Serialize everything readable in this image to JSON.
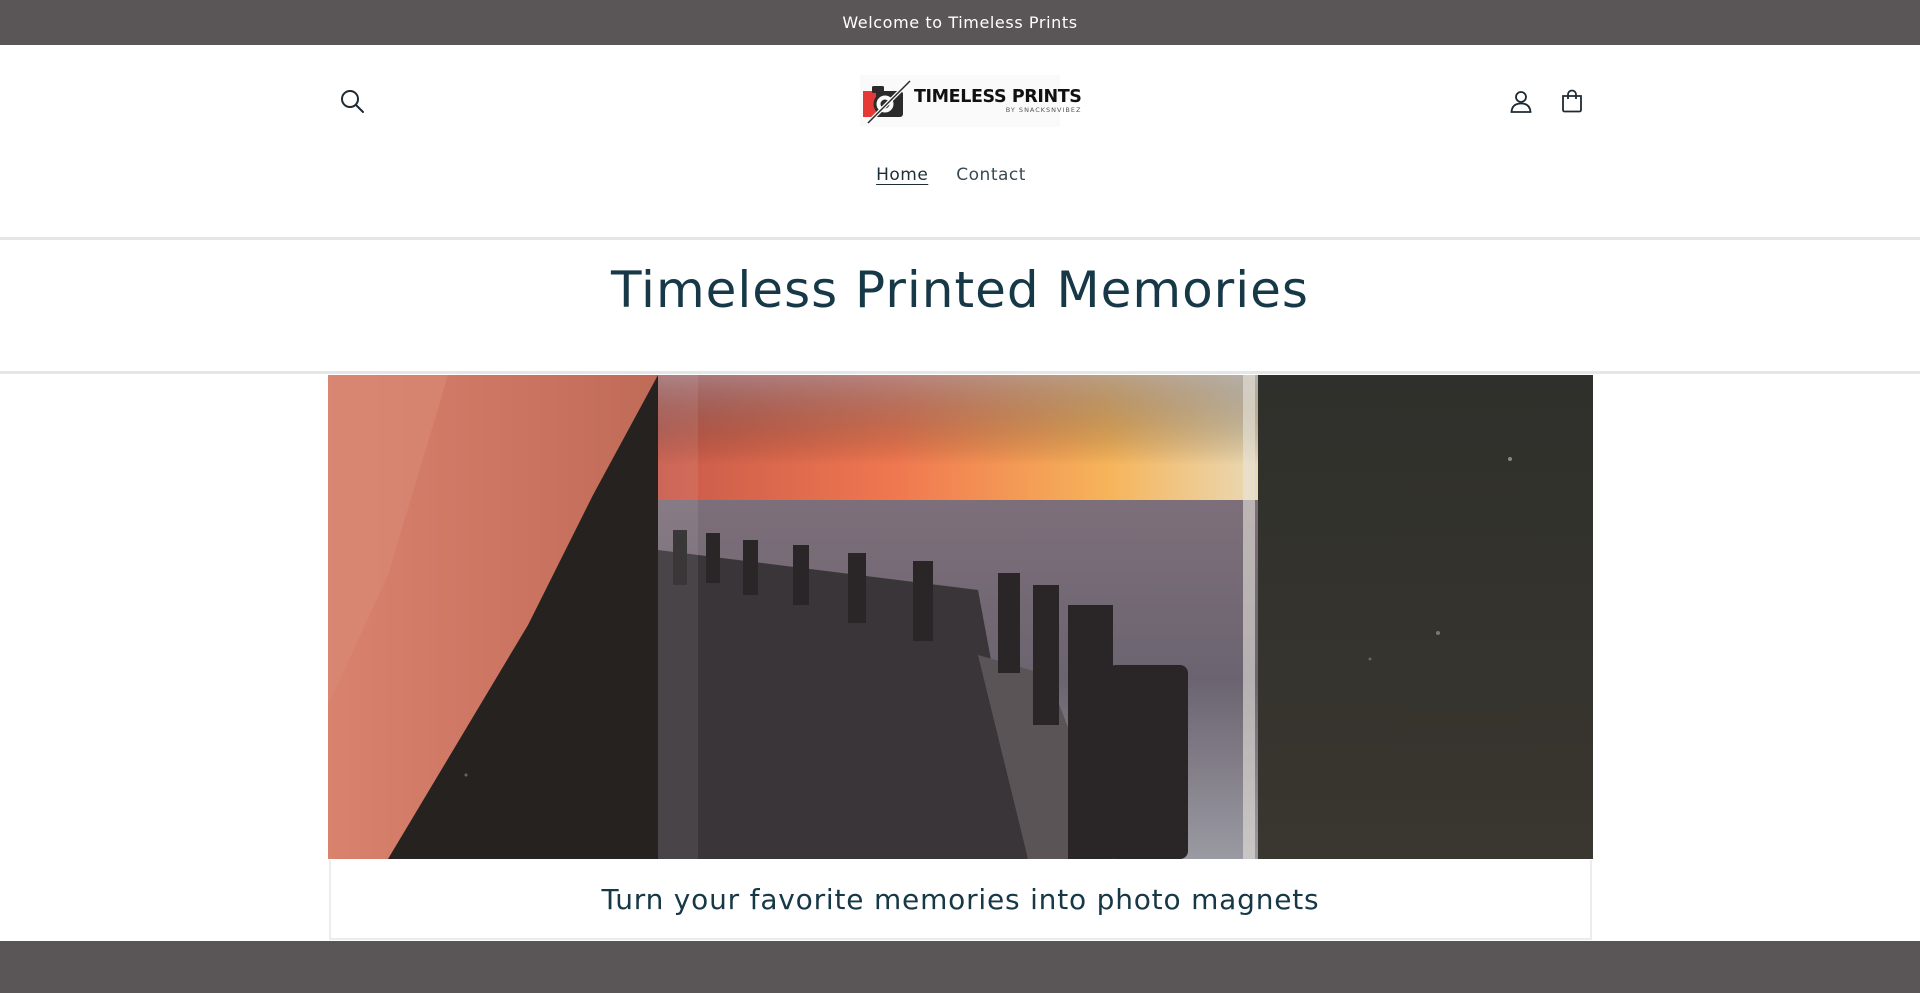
{
  "announcement": {
    "text": "Welcome to Timeless Prints"
  },
  "header": {
    "logo": {
      "title": "TIMELESS PRINTS",
      "subtitle": "BY SNACKSNVIBEZ"
    },
    "icons": {
      "search": "search-icon",
      "account": "user-icon",
      "cart": "cart-icon"
    }
  },
  "nav": {
    "items": [
      {
        "label": "Home",
        "active": true
      },
      {
        "label": "Contact",
        "active": false
      }
    ]
  },
  "hero": {
    "title": "Timeless Printed Memories"
  },
  "video": {
    "description_icon": "video-frame",
    "caption": "Turn your favorite memories into photo magnets"
  },
  "colors": {
    "announcement_bg": "#5a5557",
    "heading": "#163847",
    "footer_bg": "#5a5557",
    "logo_accent": "#e53935"
  }
}
